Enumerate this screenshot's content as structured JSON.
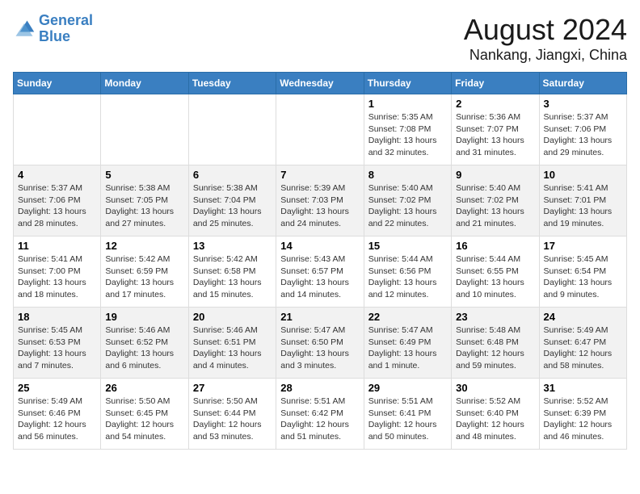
{
  "header": {
    "logo_line1": "General",
    "logo_line2": "Blue",
    "title": "August 2024",
    "subtitle": "Nankang, Jiangxi, China"
  },
  "weekdays": [
    "Sunday",
    "Monday",
    "Tuesday",
    "Wednesday",
    "Thursday",
    "Friday",
    "Saturday"
  ],
  "weeks": [
    [
      {
        "day": "",
        "info": ""
      },
      {
        "day": "",
        "info": ""
      },
      {
        "day": "",
        "info": ""
      },
      {
        "day": "",
        "info": ""
      },
      {
        "day": "1",
        "info": "Sunrise: 5:35 AM\nSunset: 7:08 PM\nDaylight: 13 hours\nand 32 minutes."
      },
      {
        "day": "2",
        "info": "Sunrise: 5:36 AM\nSunset: 7:07 PM\nDaylight: 13 hours\nand 31 minutes."
      },
      {
        "day": "3",
        "info": "Sunrise: 5:37 AM\nSunset: 7:06 PM\nDaylight: 13 hours\nand 29 minutes."
      }
    ],
    [
      {
        "day": "4",
        "info": "Sunrise: 5:37 AM\nSunset: 7:06 PM\nDaylight: 13 hours\nand 28 minutes."
      },
      {
        "day": "5",
        "info": "Sunrise: 5:38 AM\nSunset: 7:05 PM\nDaylight: 13 hours\nand 27 minutes."
      },
      {
        "day": "6",
        "info": "Sunrise: 5:38 AM\nSunset: 7:04 PM\nDaylight: 13 hours\nand 25 minutes."
      },
      {
        "day": "7",
        "info": "Sunrise: 5:39 AM\nSunset: 7:03 PM\nDaylight: 13 hours\nand 24 minutes."
      },
      {
        "day": "8",
        "info": "Sunrise: 5:40 AM\nSunset: 7:02 PM\nDaylight: 13 hours\nand 22 minutes."
      },
      {
        "day": "9",
        "info": "Sunrise: 5:40 AM\nSunset: 7:02 PM\nDaylight: 13 hours\nand 21 minutes."
      },
      {
        "day": "10",
        "info": "Sunrise: 5:41 AM\nSunset: 7:01 PM\nDaylight: 13 hours\nand 19 minutes."
      }
    ],
    [
      {
        "day": "11",
        "info": "Sunrise: 5:41 AM\nSunset: 7:00 PM\nDaylight: 13 hours\nand 18 minutes."
      },
      {
        "day": "12",
        "info": "Sunrise: 5:42 AM\nSunset: 6:59 PM\nDaylight: 13 hours\nand 17 minutes."
      },
      {
        "day": "13",
        "info": "Sunrise: 5:42 AM\nSunset: 6:58 PM\nDaylight: 13 hours\nand 15 minutes."
      },
      {
        "day": "14",
        "info": "Sunrise: 5:43 AM\nSunset: 6:57 PM\nDaylight: 13 hours\nand 14 minutes."
      },
      {
        "day": "15",
        "info": "Sunrise: 5:44 AM\nSunset: 6:56 PM\nDaylight: 13 hours\nand 12 minutes."
      },
      {
        "day": "16",
        "info": "Sunrise: 5:44 AM\nSunset: 6:55 PM\nDaylight: 13 hours\nand 10 minutes."
      },
      {
        "day": "17",
        "info": "Sunrise: 5:45 AM\nSunset: 6:54 PM\nDaylight: 13 hours\nand 9 minutes."
      }
    ],
    [
      {
        "day": "18",
        "info": "Sunrise: 5:45 AM\nSunset: 6:53 PM\nDaylight: 13 hours\nand 7 minutes."
      },
      {
        "day": "19",
        "info": "Sunrise: 5:46 AM\nSunset: 6:52 PM\nDaylight: 13 hours\nand 6 minutes."
      },
      {
        "day": "20",
        "info": "Sunrise: 5:46 AM\nSunset: 6:51 PM\nDaylight: 13 hours\nand 4 minutes."
      },
      {
        "day": "21",
        "info": "Sunrise: 5:47 AM\nSunset: 6:50 PM\nDaylight: 13 hours\nand 3 minutes."
      },
      {
        "day": "22",
        "info": "Sunrise: 5:47 AM\nSunset: 6:49 PM\nDaylight: 13 hours\nand 1 minute."
      },
      {
        "day": "23",
        "info": "Sunrise: 5:48 AM\nSunset: 6:48 PM\nDaylight: 12 hours\nand 59 minutes."
      },
      {
        "day": "24",
        "info": "Sunrise: 5:49 AM\nSunset: 6:47 PM\nDaylight: 12 hours\nand 58 minutes."
      }
    ],
    [
      {
        "day": "25",
        "info": "Sunrise: 5:49 AM\nSunset: 6:46 PM\nDaylight: 12 hours\nand 56 minutes."
      },
      {
        "day": "26",
        "info": "Sunrise: 5:50 AM\nSunset: 6:45 PM\nDaylight: 12 hours\nand 54 minutes."
      },
      {
        "day": "27",
        "info": "Sunrise: 5:50 AM\nSunset: 6:44 PM\nDaylight: 12 hours\nand 53 minutes."
      },
      {
        "day": "28",
        "info": "Sunrise: 5:51 AM\nSunset: 6:42 PM\nDaylight: 12 hours\nand 51 minutes."
      },
      {
        "day": "29",
        "info": "Sunrise: 5:51 AM\nSunset: 6:41 PM\nDaylight: 12 hours\nand 50 minutes."
      },
      {
        "day": "30",
        "info": "Sunrise: 5:52 AM\nSunset: 6:40 PM\nDaylight: 12 hours\nand 48 minutes."
      },
      {
        "day": "31",
        "info": "Sunrise: 5:52 AM\nSunset: 6:39 PM\nDaylight: 12 hours\nand 46 minutes."
      }
    ]
  ]
}
